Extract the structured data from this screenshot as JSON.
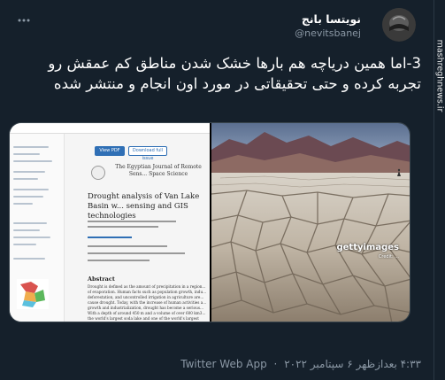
{
  "tweet": {
    "author_name": "نویتسا بانج",
    "author_handle": "@nevitsbanej",
    "text": "3-اما همین دریاچه هم بارها خشک شدن مناطق کم عمقش رو تجربه کرده و حتی تحقیقاتی در مورد اون انجام و منتشر شده",
    "time": "۴:۳۳ بعدازظهر",
    "date": "۶ سپتامبر ۲۰۲۲",
    "source": "Twitter Web App",
    "separator": "·"
  },
  "watermark": "mashreghnews.ir",
  "media": {
    "paper": {
      "pdf_button": "View PDF",
      "download_button": "Download full issue",
      "journal_name": "The Egyptian Journal of Remote Sens... Space Science",
      "paper_title": "Drought analysis of Van Lake Basin w... sensing and GIS technologies",
      "abstract_heading": "Abstract",
      "abstract_text": "Drought is defined as the amount of precipitation in a region... of evaporation. Human facts such as population growth, indu... deforestation, and uncontrolled irrigation in agriculture are... cause drought. Today, with the increase of human activities a... growth and industrialization, drought has become a serious... With a depth of around 450 m and a volume of over 600 km3... the world's largest soda lake and one of the world's largest clo... Increasing temperatures and decreasing precipitation in rece... there may be a drought in Lake Van. It is important to analyz..."
    },
    "photo": {
      "credit_brand": "gettyimages",
      "credit_sub": "Credit: ..."
    }
  }
}
